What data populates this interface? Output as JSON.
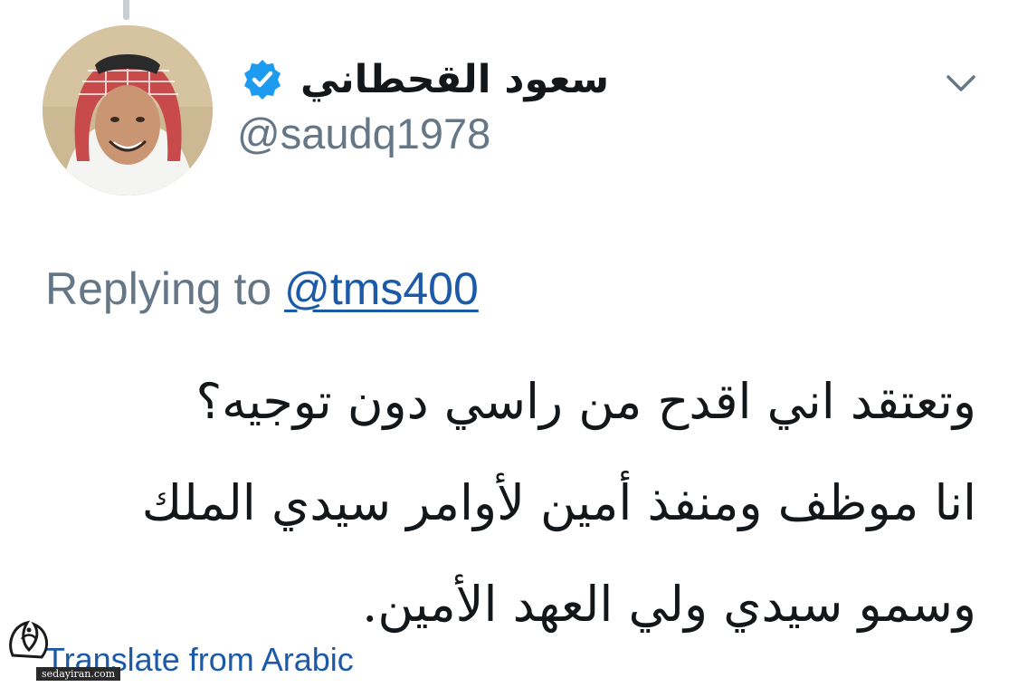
{
  "tweet": {
    "display_name": "سعود القحطاني",
    "handle": "@saudq1978",
    "reply_prefix": "Replying to",
    "reply_mention": "@tms400",
    "text_lines": [
      "وتعتقد اني اقدح من راسي دون توجيه؟",
      "انا موظف ومنفذ أمين لأوامر سيدي الملك",
      "وسمو سيدي ولي العهد الأمين."
    ],
    "translate_label": "Translate from Arabic"
  },
  "watermark": {
    "url": "sedayiran.com"
  },
  "icons": {
    "verified": "verified-badge-icon",
    "menu": "chevron-down-icon"
  },
  "colors": {
    "text": "#14171a",
    "secondary": "#657786",
    "link": "#1b5aa8",
    "verified": "#1d9bf0"
  }
}
